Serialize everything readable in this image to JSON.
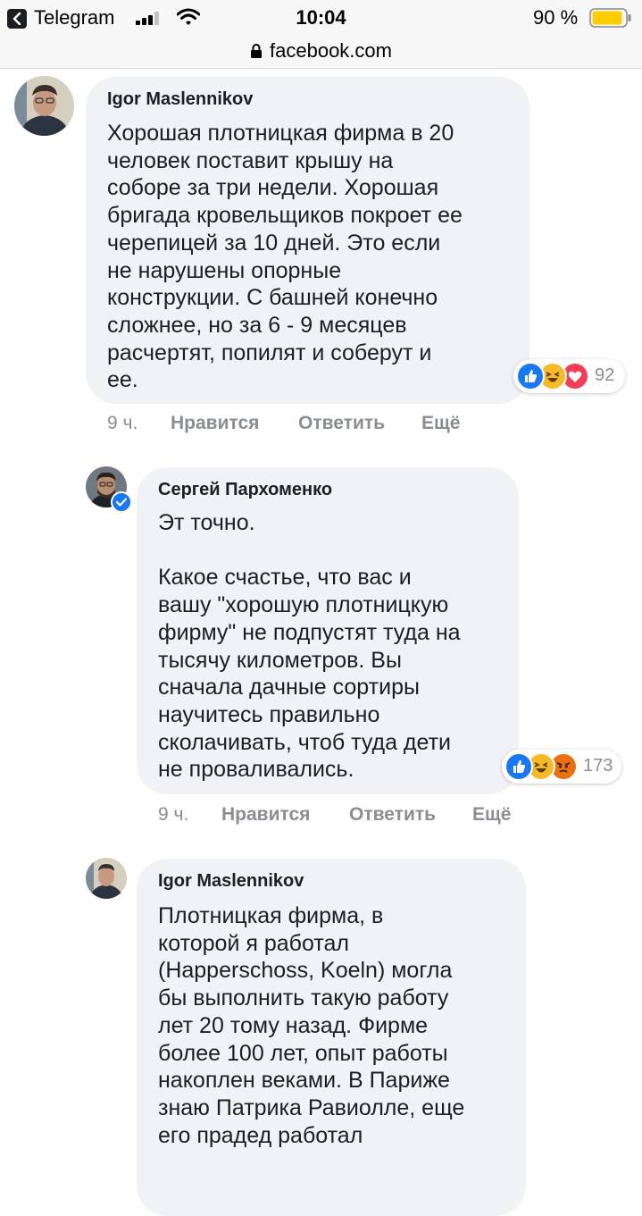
{
  "status_bar": {
    "back_app": "Telegram",
    "time": "10:04",
    "battery": "90 %",
    "signal_bars": 3
  },
  "url_bar": {
    "url": "facebook.com"
  },
  "comments": [
    {
      "author": "Igor Maslennikov",
      "text": "Хорошая плотницкая фирма в 20\nчеловек поставит крышу на\nсоборе за три недели. Хорошая\nбригада кровельщиков покроет ее\nчерепицей за 10 дней. Это если\nне нарушены опорные\nконструкции. С башней конечно\nсложнее, но за 6 - 9 месяцев\nрасчертят, попилят и соберут и\nее.",
      "reactions": [
        "like",
        "haha",
        "love"
      ],
      "reaction_count": "92",
      "time": "9 ч.",
      "like_label": "Нравится",
      "reply_label": "Ответить",
      "more_label": "Ещё"
    },
    {
      "author": "Сергей Пархоменко",
      "verified": true,
      "text": "Эт точно.\n\nКакое счастье, что вас и\nвашу \"хорошую плотницкую\nфирму\" не подпустят туда на\nтысячу километров. Вы\nсначала дачные сортиры\nнаучитесь правильно\nсколачивать, чтоб туда дети\nне проваливались.",
      "reactions": [
        "like",
        "haha",
        "angry"
      ],
      "reaction_count": "173",
      "time": "9 ч.",
      "like_label": "Нравится",
      "reply_label": "Ответить",
      "more_label": "Ещё"
    },
    {
      "author": "Igor Maslennikov",
      "text": "Плотницкая фирма, в\nкоторой я работал\n(Happerschoss, Koeln) могла\nбы выполнить такую работу\nлет 20 тому назад. Фирме\nболее 100 лет, опыт работы\nнакоплен веками. В Париже\nзнаю Патрика Равиолле, еще\nего прадед работал"
    }
  ]
}
